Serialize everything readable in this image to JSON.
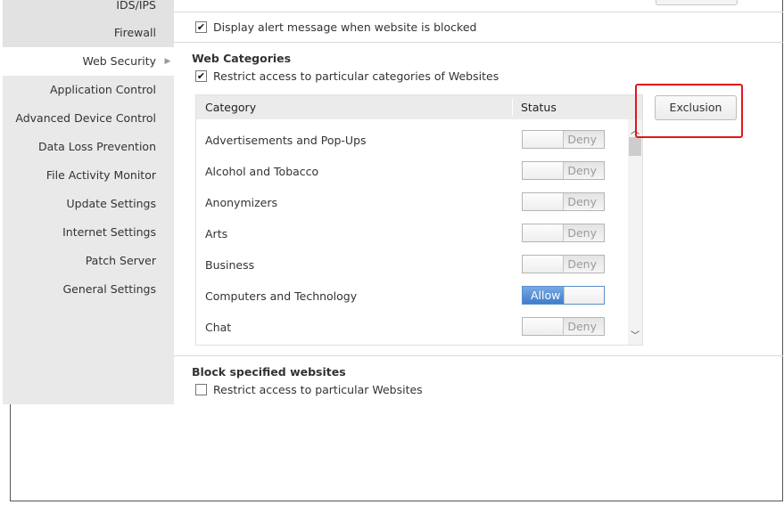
{
  "sidebar": {
    "items": [
      {
        "label": "IDS/IPS"
      },
      {
        "label": "Firewall"
      },
      {
        "label": "Web Security",
        "active": true
      },
      {
        "label": "Application Control"
      },
      {
        "label": "Advanced Device Control"
      },
      {
        "label": "Data Loss Prevention"
      },
      {
        "label": "File Activity Monitor"
      },
      {
        "label": "Update Settings"
      },
      {
        "label": "Internet Settings"
      },
      {
        "label": "Patch Server"
      },
      {
        "label": "General Settings"
      }
    ]
  },
  "main": {
    "display_alert": {
      "label": "Display alert message when website is blocked",
      "checked": true
    },
    "web_categories": {
      "title": "Web Categories",
      "restrict": {
        "label": "Restrict access to particular categories of Websites",
        "checked": true
      },
      "columns": {
        "category": "Category",
        "status": "Status"
      },
      "rows": [
        {
          "name": "Advertisements and Pop-Ups",
          "status": "Deny"
        },
        {
          "name": "Alcohol and Tobacco",
          "status": "Deny"
        },
        {
          "name": "Anonymizers",
          "status": "Deny"
        },
        {
          "name": "Arts",
          "status": "Deny"
        },
        {
          "name": "Business",
          "status": "Deny"
        },
        {
          "name": "Computers and Technology",
          "status": "Allow"
        },
        {
          "name": "Chat",
          "status": "Deny"
        }
      ],
      "exclusion_label": "Exclusion"
    },
    "block_sites": {
      "title": "Block specified websites",
      "restrict": {
        "label": "Restrict access to particular Websites",
        "checked": false
      }
    }
  },
  "colors": {
    "highlight": "#e0161b",
    "allow_blue": "#3e7ccc",
    "sidebar_bg": "#e9e9e9"
  }
}
